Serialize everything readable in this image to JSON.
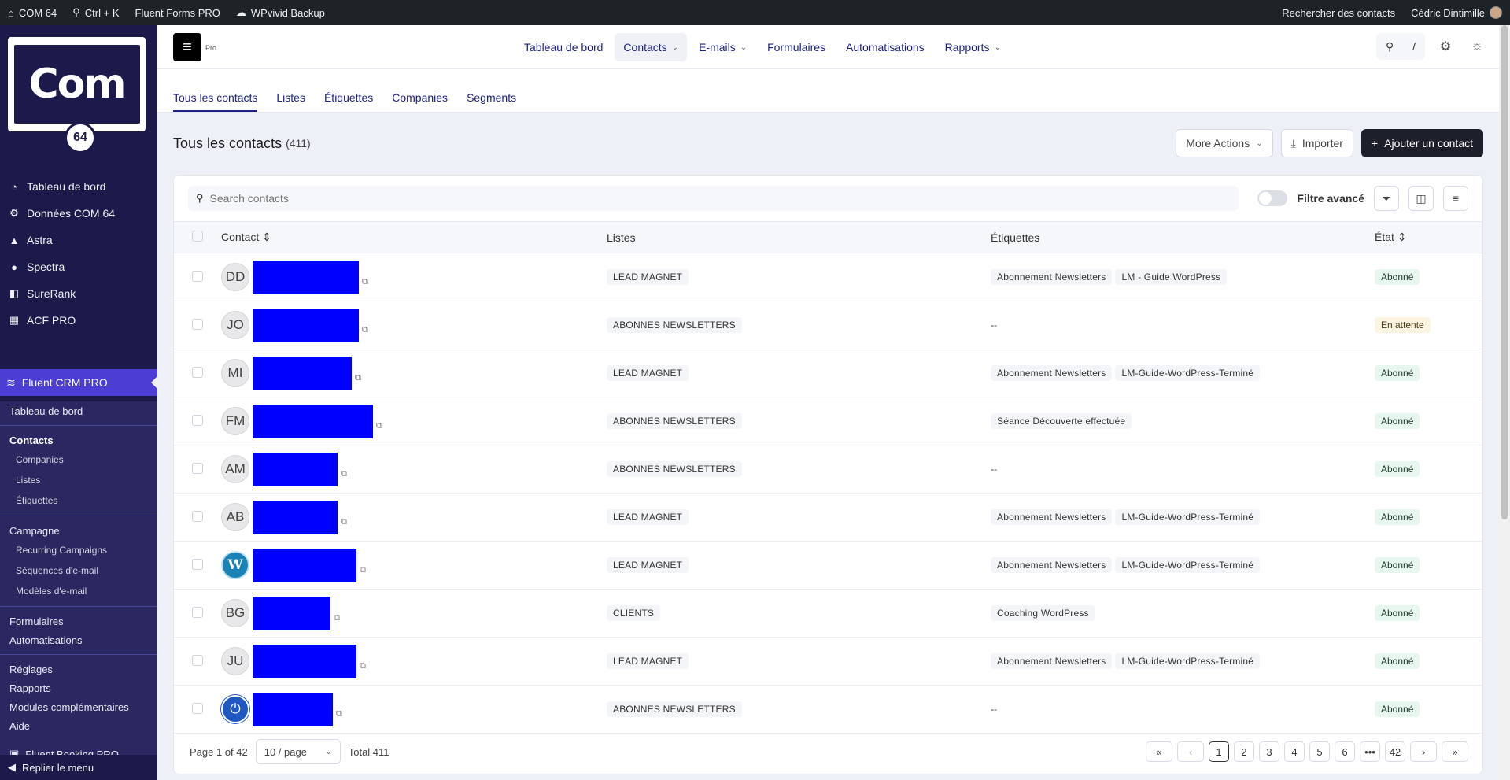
{
  "adminbar": {
    "site": "COM 64",
    "shortcut": "Ctrl + K",
    "forms": "Fluent Forms PRO",
    "backup": "WPvivid Backup",
    "search_contacts": "Rechercher des contacts",
    "user": "Cédric Dintimille"
  },
  "sidebar": {
    "logo_text": "Com",
    "logo_badge": "64",
    "items": [
      {
        "label": "Tableau de bord",
        "icon": "dashboard-icon"
      },
      {
        "label": "Données COM 64",
        "icon": "gear-icon"
      },
      {
        "label": "Astra",
        "icon": "astra-icon"
      },
      {
        "label": "Spectra",
        "icon": "spectra-icon"
      },
      {
        "label": "SureRank",
        "icon": "surerank-icon"
      },
      {
        "label": "ACF PRO",
        "icon": "acf-icon"
      }
    ],
    "active": "Fluent CRM PRO",
    "submenu": {
      "dashboard": "Tableau de bord",
      "contacts": "Contacts",
      "companies": "Companies",
      "lists": "Listes",
      "tags": "Étiquettes",
      "campaign": "Campagne",
      "recurring": "Recurring Campaigns",
      "sequences": "Séquences d'e-mail",
      "templates": "Modèles d'e-mail",
      "forms": "Formulaires",
      "automations": "Automatisations",
      "settings": "Réglages",
      "reports": "Rapports",
      "addons": "Modules complémentaires",
      "help": "Aide",
      "booking": "Fluent Booking PRO"
    },
    "collapse": "Replier le menu"
  },
  "topnav": {
    "pro": "Pro",
    "links": [
      "Tableau de bord",
      "Contacts",
      "E-mails",
      "Formulaires",
      "Automatisations",
      "Rapports"
    ],
    "search_shortcut": "/"
  },
  "subtabs": [
    "Tous les contacts",
    "Listes",
    "Étiquettes",
    "Companies",
    "Segments"
  ],
  "page": {
    "title": "Tous les contacts",
    "count": "(411)",
    "more_actions": "More Actions",
    "import": "Importer",
    "add_contact": "Ajouter un contact"
  },
  "filters": {
    "search_placeholder": "Search contacts",
    "advanced": "Filtre avancé"
  },
  "table": {
    "headers": {
      "contact": "Contact",
      "lists": "Listes",
      "tags": "Étiquettes",
      "status": "État"
    },
    "rows": [
      {
        "initials": "DD",
        "redact_fraction": 0.45,
        "lists": [
          "LEAD MAGNET"
        ],
        "tags": [
          "Abonnement Newsletters",
          "LM - Guide WordPress"
        ],
        "status": "Abonné",
        "status_type": "ok"
      },
      {
        "initials": "JO",
        "redact_fraction": 0.45,
        "lists": [
          "ABONNES NEWSLETTERS"
        ],
        "tags": [
          "--"
        ],
        "status": "En attente",
        "status_type": "wait"
      },
      {
        "initials": "MI",
        "redact_fraction": 0.42,
        "lists": [
          "LEAD MAGNET"
        ],
        "tags": [
          "Abonnement Newsletters",
          "LM-Guide-WordPress-Terminé"
        ],
        "status": "Abonné",
        "status_type": "ok"
      },
      {
        "initials": "FM",
        "redact_fraction": 0.51,
        "lists": [
          "ABONNES NEWSLETTERS"
        ],
        "tags": [
          "Séance Découverte effectuée"
        ],
        "status": "Abonné",
        "status_type": "ok"
      },
      {
        "initials": "AM",
        "redact_fraction": 0.36,
        "lists": [
          "ABONNES NEWSLETTERS"
        ],
        "tags": [
          "--"
        ],
        "status": "Abonné",
        "status_type": "ok"
      },
      {
        "initials": "AB",
        "redact_fraction": 0.36,
        "lists": [
          "LEAD MAGNET"
        ],
        "tags": [
          "Abonnement Newsletters",
          "LM-Guide-WordPress-Terminé"
        ],
        "status": "Abonné",
        "status_type": "ok"
      },
      {
        "initials": "",
        "avatar": "wordpress",
        "redact_fraction": 0.44,
        "lists": [
          "LEAD MAGNET"
        ],
        "tags": [
          "Abonnement Newsletters",
          "LM-Guide-WordPress-Terminé"
        ],
        "status": "Abonné",
        "status_type": "ok"
      },
      {
        "initials": "BG",
        "redact_fraction": 0.33,
        "lists": [
          "CLIENTS"
        ],
        "tags": [
          "Coaching WordPress"
        ],
        "status": "Abonné",
        "status_type": "ok"
      },
      {
        "initials": "JU",
        "redact_fraction": 0.44,
        "lists": [
          "LEAD MAGNET"
        ],
        "tags": [
          "Abonnement Newsletters",
          "LM-Guide-WordPress-Terminé"
        ],
        "status": "Abonné",
        "status_type": "ok"
      },
      {
        "initials": "",
        "avatar": "power",
        "redact_fraction": 0.34,
        "lists": [
          "ABONNES NEWSLETTERS"
        ],
        "tags": [
          "--"
        ],
        "status": "Abonné",
        "status_type": "ok"
      }
    ]
  },
  "pager": {
    "page_of": "Page 1 of 42",
    "per_page": "10 / page",
    "total": "Total 411",
    "first": "«",
    "prev": "‹",
    "pages": [
      "1",
      "2",
      "3",
      "4",
      "5",
      "6",
      "•••",
      "42"
    ],
    "current": "1",
    "next": "›",
    "last": "»"
  }
}
